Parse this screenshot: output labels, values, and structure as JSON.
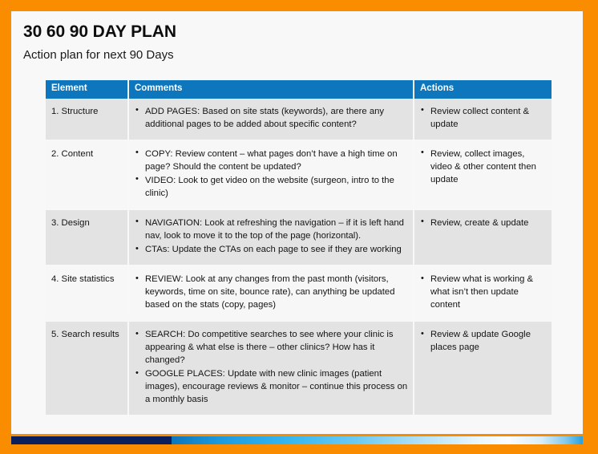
{
  "slide": {
    "title": "30 60 90 DAY PLAN",
    "subtitle": "Action plan for next 90 Days",
    "border_color": "#FA8C00",
    "canvas_color": "#F8F8F8"
  },
  "table": {
    "header_color": "#0E76BC",
    "headers": {
      "element": "Element",
      "comments": "Comments",
      "actions": "Actions"
    },
    "rows": [
      {
        "element": "1. Structure",
        "comments": [
          "ADD PAGES: Based on site stats (keywords), are there any additional pages to be added about specific content?"
        ],
        "actions": [
          "Review collect content & update"
        ]
      },
      {
        "element": "2. Content",
        "comments": [
          "COPY: Review content – what pages don’t have a high time on page? Should the content be updated?",
          "VIDEO: Look to get video on the website (surgeon, intro to the clinic)"
        ],
        "actions": [
          "Review, collect images, video & other content then update"
        ]
      },
      {
        "element": "3. Design",
        "comments": [
          "NAVIGATION: Look at refreshing the navigation – if it is left hand nav, look to move it to the top of the page (horizontal).",
          "CTAs: Update the CTAs on each page to see if they are working"
        ],
        "actions": [
          "Review, create & update"
        ]
      },
      {
        "element": "4. Site statistics",
        "comments": [
          "REVIEW: Look at any changes from the past month (visitors, keywords, time on site, bounce rate), can anything be updated based on the stats (copy, pages)"
        ],
        "actions": [
          "Review what is working & what isn’t then update content"
        ]
      },
      {
        "element": "5. Search results",
        "comments": [
          "SEARCH: Do competitive searches to see where your clinic is appearing & what else is there – other clinics? How has it changed?",
          "GOOGLE PLACES: Update with new clinic images (patient images), encourage reviews & monitor – continue this process on a monthly basis"
        ],
        "actions": [
          "Review & update Google places page"
        ]
      }
    ]
  },
  "footer": {
    "navy_color": "#0B1F5E",
    "gradient_start_color": "#0E76BC",
    "gradient_end_color": "#FFFFFF"
  }
}
